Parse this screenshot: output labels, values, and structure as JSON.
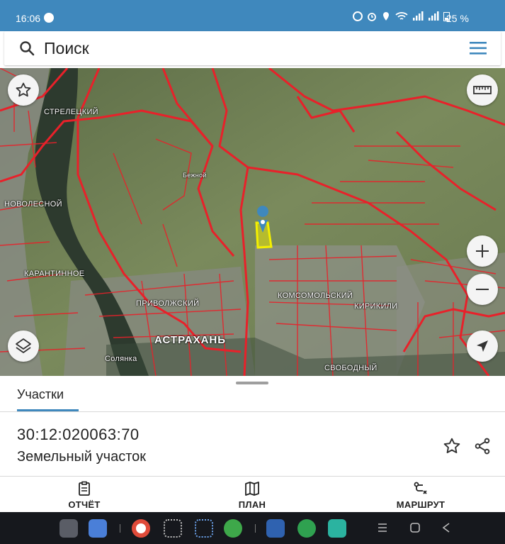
{
  "status_bar": {
    "time": "16:06",
    "battery": "25 %"
  },
  "search": {
    "placeholder": "Поиск"
  },
  "map": {
    "labels": {
      "streletskiy": "СТРЕЛЕЦКИЙ",
      "novolesnoy": "НОВОЛЕСНОЙ",
      "karantinnoe": "КАРАНТИННОЕ",
      "privolzhskiy": "ПРИВОЛЖСКИЙ",
      "astrakhan": "АСТРАХАНЬ",
      "solyanka": "Солянка",
      "komsomolskiy": "КОМСОМОЛЬСКИЙ",
      "kirikili": "КИРИКИЛИ",
      "svobodnyy": "СВОБОДНЫЙ",
      "bezhnoy": "Бежной"
    },
    "colors": {
      "boundary": "#e8212a",
      "selected_parcel": "#f4f000",
      "pin": "#3f88bd"
    }
  },
  "sheet": {
    "tab_label": "Участки",
    "parcel": {
      "number": "30:12:020063:70",
      "type": "Земельный участок"
    }
  },
  "actions": {
    "report": "ОТЧЁТ",
    "plan": "ПЛАН",
    "route": "МАРШРУТ"
  },
  "accent_color": "#3f88bd"
}
